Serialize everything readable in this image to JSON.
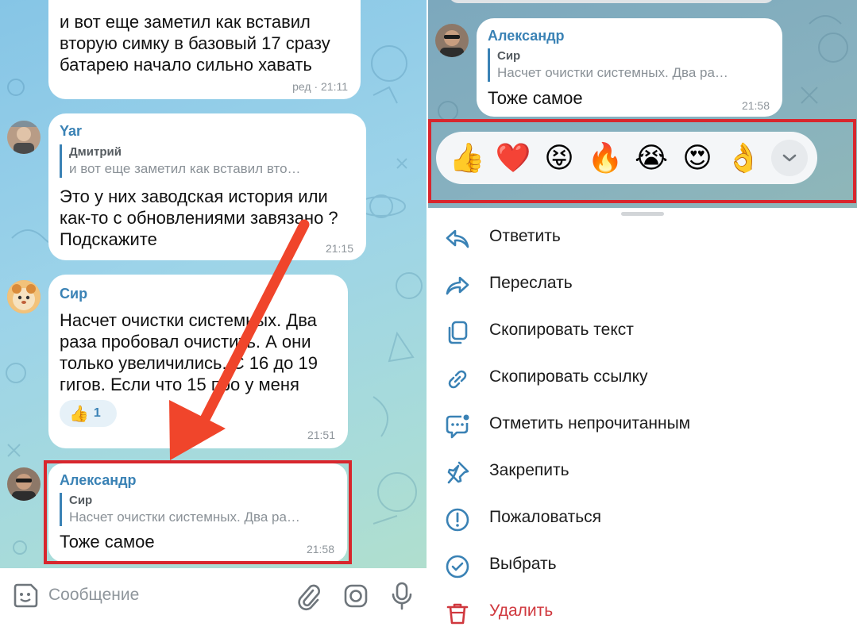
{
  "left": {
    "messages": [
      {
        "text_lines": [
          "и вот еще заметил как вставил",
          "вторую симку в базовый 17 сразу",
          "батарею начало сильно хавать"
        ],
        "time": "ред · 21:11"
      },
      {
        "sender": "Yar",
        "reply_name": "Дмитрий",
        "reply_text": "и вот еще заметил как вставил вто…",
        "text_lines": [
          "Это у них заводская история или",
          "как-то с обновлениями завязано ?",
          "Подскажите"
        ],
        "time": "21:15"
      },
      {
        "sender": "Сир",
        "text_lines": [
          "Насчет очистки системных. Два",
          "раза пробовал очистить. А они",
          "только увеличились. С 16 до 19",
          "гигов. Если что 15 про у меня"
        ],
        "reaction_emoji": "👍",
        "reaction_count": "1",
        "time": "21:51"
      },
      {
        "sender": "Александр",
        "reply_name": "Сир",
        "reply_text": "Насчет очистки системных. Два ра…",
        "text": "Тоже самое",
        "time": "21:58"
      }
    ],
    "input_placeholder": "Сообщение"
  },
  "right": {
    "message": {
      "sender": "Александр",
      "reply_name": "Сир",
      "reply_text": "Насчет очистки системных. Два ра…",
      "text": "Тоже самое",
      "time": "21:58"
    },
    "reactions": [
      "👍",
      "❤️",
      "😝",
      "🔥",
      "😭",
      "😍",
      "👌"
    ],
    "menu": [
      {
        "label": "Ответить",
        "icon": "reply-icon"
      },
      {
        "label": "Переслать",
        "icon": "forward-icon"
      },
      {
        "label": "Скопировать текст",
        "icon": "copy-icon"
      },
      {
        "label": "Скопировать ссылку",
        "icon": "link-icon"
      },
      {
        "label": "Отметить непрочитанным",
        "icon": "mark-unread-icon"
      },
      {
        "label": "Закрепить",
        "icon": "pin-icon"
      },
      {
        "label": "Пожаловаться",
        "icon": "report-icon"
      },
      {
        "label": "Выбрать",
        "icon": "select-icon"
      },
      {
        "label": "Удалить",
        "icon": "delete-icon"
      }
    ]
  },
  "colors": {
    "accent": "#3a82b5",
    "highlight_frame": "#d8262d",
    "arrow": "#f0452b",
    "danger": "#d0383e"
  }
}
